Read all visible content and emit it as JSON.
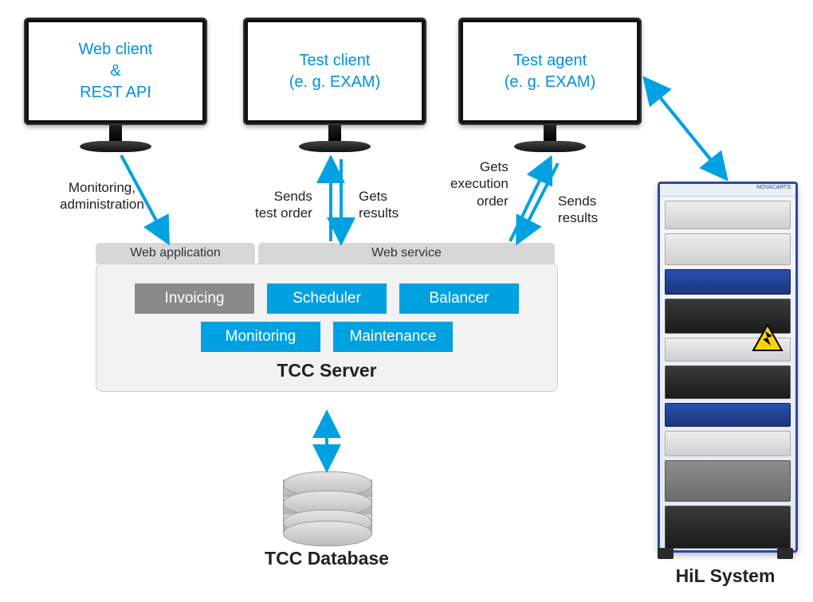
{
  "monitors": {
    "web_client": "Web client\n&\nREST API",
    "test_client": "Test client\n(e. g. EXAM)",
    "test_agent": "Test agent\n(e. g. EXAM)"
  },
  "arrows": {
    "monitoring_admin": "Monitoring,\nadministration",
    "sends_test_order": "Sends\ntest order",
    "gets_results": "Gets\nresults",
    "gets_exec_order": "Gets\nexecution\norder",
    "sends_results": "Sends\nresults"
  },
  "server_tabs": {
    "web_application": "Web application",
    "web_service": "Web service"
  },
  "server_modules": {
    "invoicing": "Invoicing",
    "scheduler": "Scheduler",
    "balancer": "Balancer",
    "monitoring": "Monitoring",
    "maintenance": "Maintenance"
  },
  "server_title": "TCC Server",
  "database_label": "TCC Database",
  "hil_label": "HiL System",
  "rack_brand": "NOVACARTS"
}
